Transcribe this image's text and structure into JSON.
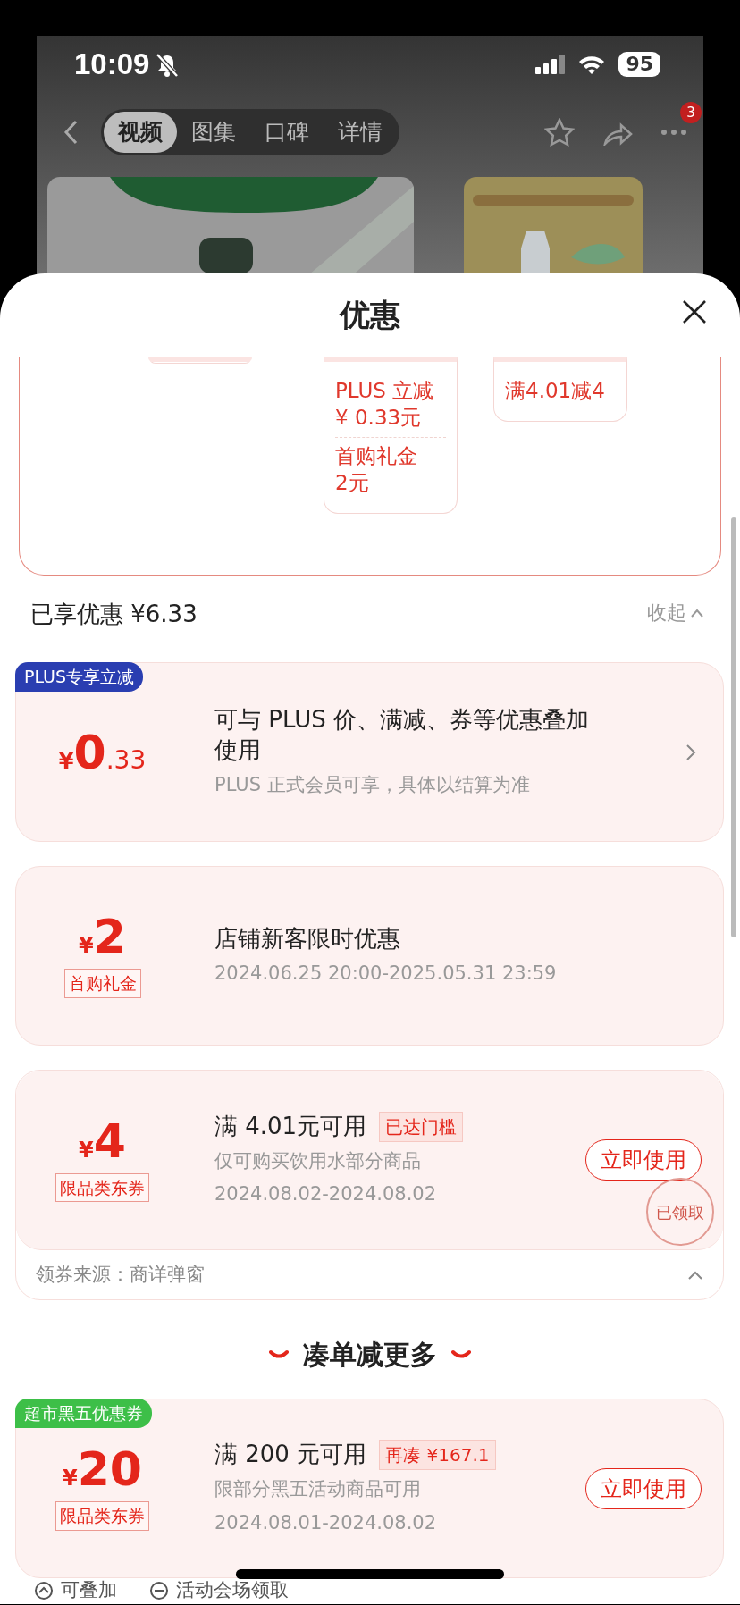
{
  "status_bar": {
    "time": "10:09",
    "battery": "95"
  },
  "nav": {
    "tabs": [
      {
        "label": "视频",
        "selected": true
      },
      {
        "label": "图集",
        "selected": false
      },
      {
        "label": "口碑",
        "selected": false
      },
      {
        "label": "详情",
        "selected": false
      }
    ],
    "more_badge": "3"
  },
  "sheet": {
    "title": "优惠"
  },
  "summary_card": {
    "columns": [
      {},
      {
        "items": [
          "PLUS 立减\n¥ 0.33元",
          "首购礼金\n2元"
        ]
      },
      {
        "items": [
          "满4.01减4"
        ]
      }
    ]
  },
  "applied": {
    "label": "已享优惠 ¥6.33",
    "collapse": "收起"
  },
  "coupons": [
    {
      "badge": {
        "text": "PLUS专享立减",
        "color": "#2a3eb1"
      },
      "currency": "¥",
      "amount": "0",
      "decimals": ".33",
      "title": "可与 PLUS 价、满减、券等优惠叠加使用",
      "desc": "PLUS 正式会员可享，具体以结算为准",
      "chevron": true
    },
    {
      "currency": "¥",
      "amount": "2",
      "tag": "首购礼金",
      "title": "店铺新客限时优惠",
      "dates": "2024.06.25 20:00-2025.05.31 23:59"
    },
    {
      "currency": "¥",
      "amount": "4",
      "tag": "限品类东券",
      "title": "满 4.01元可用",
      "title_tag": "已达门槛",
      "desc": "仅可购买饮用水部分商品",
      "dates": "2024.08.02-2024.08.02",
      "action": "立即使用",
      "stamp": "已领取",
      "source": "领券来源：商详弹窗"
    }
  ],
  "more_section": {
    "title": "凑单减更多"
  },
  "more_coupons": [
    {
      "badge": {
        "text": "超市黑五优惠券",
        "color": "#3dbf48"
      },
      "currency": "¥",
      "amount": "20",
      "tag": "限品类东券",
      "title": "满 200 元可用",
      "title_tag": "再凑 ¥167.1",
      "desc": "限部分黑五活动商品可用",
      "dates": "2024.08.01-2024.08.02",
      "action": "立即使用"
    }
  ],
  "footer": {
    "items": [
      {
        "kind": "stack",
        "text": "可叠加"
      },
      {
        "kind": "venue",
        "text": "活动会场领取"
      }
    ]
  }
}
